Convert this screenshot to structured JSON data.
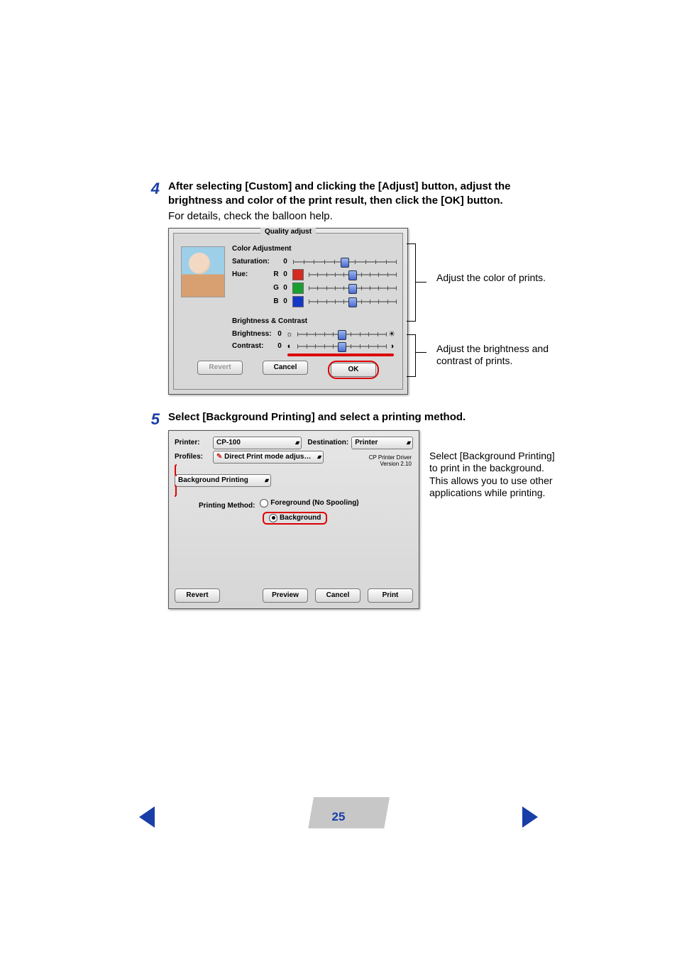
{
  "page_number": "25",
  "steps": {
    "s4": {
      "num": "4",
      "title": "After selecting [Custom] and clicking the [Adjust] button, adjust the brightness and color of the print result, then click the [OK] button.",
      "sub": "For details, check the balloon help."
    },
    "s5": {
      "num": "5",
      "title": "Select [Background Printing] and select a printing method."
    }
  },
  "callouts": {
    "color": "Adjust the color of prints.",
    "bright": "Adjust the brightness and contrast of prints.",
    "bg": "Select [Background Printing] to print in the background. This allows you to use other applications while printing."
  },
  "quality_panel": {
    "legend": "Quality adjust",
    "section_color": "Color Adjustment",
    "saturation_label": "Saturation:",
    "hue_label": "Hue:",
    "chan_r": "R",
    "chan_g": "G",
    "chan_b": "B",
    "zero": "0",
    "section_bc": "Brightness & Contrast",
    "brightness_label": "Brightness:",
    "contrast_label": "Contrast:",
    "revert": "Revert",
    "cancel": "Cancel",
    "ok": "OK"
  },
  "print_panel": {
    "printer_label": "Printer:",
    "printer_value": "CP-100",
    "dest_label": "Destination:",
    "dest_value": "Printer",
    "profiles_label": "Profiles:",
    "profiles_value": "Direct Print mode adjus…",
    "section_value": "Background Printing",
    "driver_name": "CP Printer Driver",
    "driver_version": "Version 2.10",
    "pm_label": "Printing Method:",
    "pm_fore": "Foreground (No Spooling)",
    "pm_back": "Background",
    "revert": "Revert",
    "preview": "Preview",
    "cancel": "Cancel",
    "print": "Print"
  },
  "colors": {
    "red": "#d42a1f",
    "green": "#17a02e",
    "blue": "#1338c9"
  }
}
